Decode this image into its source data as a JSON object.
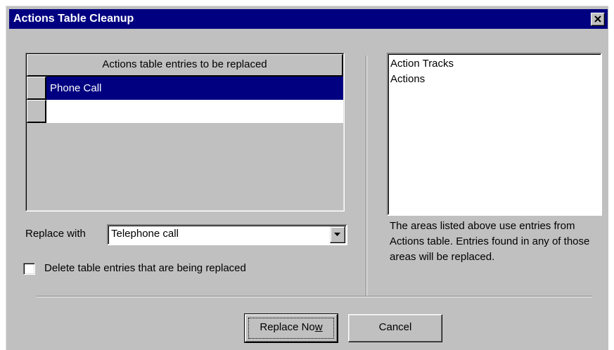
{
  "window": {
    "title": "Actions Table Cleanup",
    "close_icon": "close-icon"
  },
  "grid": {
    "header": "Actions table entries to be replaced",
    "rows": [
      {
        "value": "Phone Call",
        "selected": true
      },
      {
        "value": "",
        "selected": false
      }
    ]
  },
  "areas": {
    "items": [
      "Action Tracks",
      "Actions"
    ],
    "note": "The areas listed above use entries from Actions table. Entries found in any of those areas will be replaced."
  },
  "replace": {
    "label": "Replace with",
    "value": "Telephone call",
    "dropdown_icon": "chevron-down-icon"
  },
  "delete_option": {
    "label": "Delete table entries that are being replaced",
    "checked": false
  },
  "buttons": {
    "replace_now_prefix": "Replace No",
    "replace_now_accel": "w",
    "cancel": "Cancel"
  },
  "colors": {
    "title_bar": "#000080",
    "dialog_face": "#c0c0c0",
    "selection": "#000080"
  }
}
